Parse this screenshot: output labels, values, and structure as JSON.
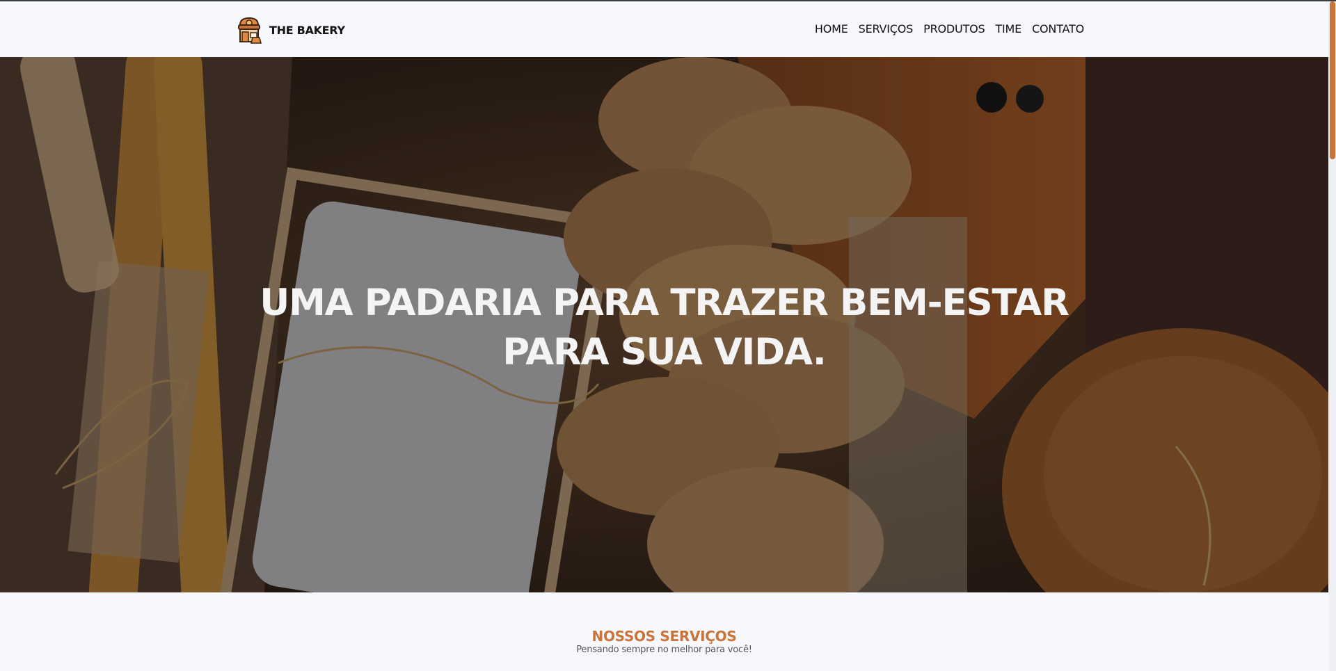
{
  "header": {
    "brand": "THE BAKERY",
    "logo_icon": "bakery-shop-icon",
    "nav": [
      "HOME",
      "SERVIÇOS",
      "PRODUTOS",
      "TIME",
      "CONTATO"
    ]
  },
  "hero": {
    "title": "UMA PADARIA PARA TRAZER BEM-ESTAR PARA SUA VIDA.",
    "background": "bread-photo"
  },
  "services": {
    "title": "NOSSOS SERVIÇOS",
    "subtitle": "Pensando sempre no melhor para você!"
  },
  "colors": {
    "accent": "#c8743a",
    "text": "#111111",
    "background": "#f6f8fb"
  }
}
